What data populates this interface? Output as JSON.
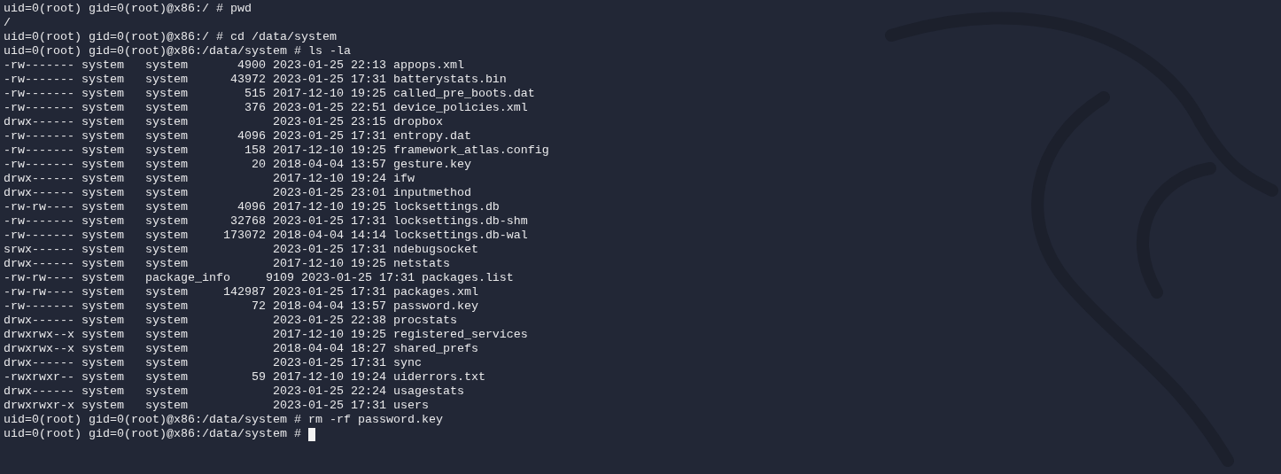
{
  "terminal": {
    "lines": [
      {
        "kind": "command",
        "prompt": "uid=0(root) gid=0(root)@x86:/ #",
        "command": "pwd"
      },
      {
        "kind": "output",
        "text": "/"
      },
      {
        "kind": "command",
        "prompt": "uid=0(root) gid=0(root)@x86:/ #",
        "command": "cd /data/system"
      },
      {
        "kind": "command",
        "prompt": "uid=0(root) gid=0(root)@x86:/data/system #",
        "command": "ls -la"
      },
      {
        "kind": "output",
        "text": "-rw------- system   system       4900 2023-01-25 22:13 appops.xml"
      },
      {
        "kind": "output",
        "text": "-rw------- system   system      43972 2023-01-25 17:31 batterystats.bin"
      },
      {
        "kind": "output",
        "text": "-rw------- system   system        515 2017-12-10 19:25 called_pre_boots.dat"
      },
      {
        "kind": "output",
        "text": "-rw------- system   system        376 2023-01-25 22:51 device_policies.xml"
      },
      {
        "kind": "output",
        "text": "drwx------ system   system            2023-01-25 23:15 dropbox"
      },
      {
        "kind": "output",
        "text": "-rw------- system   system       4096 2023-01-25 17:31 entropy.dat"
      },
      {
        "kind": "output",
        "text": "-rw------- system   system        158 2017-12-10 19:25 framework_atlas.config"
      },
      {
        "kind": "output",
        "text": "-rw------- system   system         20 2018-04-04 13:57 gesture.key"
      },
      {
        "kind": "output",
        "text": "drwx------ system   system            2017-12-10 19:24 ifw"
      },
      {
        "kind": "output",
        "text": "drwx------ system   system            2023-01-25 23:01 inputmethod"
      },
      {
        "kind": "output",
        "text": "-rw-rw---- system   system       4096 2017-12-10 19:25 locksettings.db"
      },
      {
        "kind": "output",
        "text": "-rw------- system   system      32768 2023-01-25 17:31 locksettings.db-shm"
      },
      {
        "kind": "output",
        "text": "-rw------- system   system     173072 2018-04-04 14:14 locksettings.db-wal"
      },
      {
        "kind": "output",
        "text": "srwx------ system   system            2023-01-25 17:31 ndebugsocket"
      },
      {
        "kind": "output",
        "text": "drwx------ system   system            2017-12-10 19:25 netstats"
      },
      {
        "kind": "output",
        "text": "-rw-rw---- system   package_info     9109 2023-01-25 17:31 packages.list"
      },
      {
        "kind": "output",
        "text": "-rw-rw---- system   system     142987 2023-01-25 17:31 packages.xml"
      },
      {
        "kind": "output",
        "text": "-rw------- system   system         72 2018-04-04 13:57 password.key"
      },
      {
        "kind": "output",
        "text": "drwx------ system   system            2023-01-25 22:38 procstats"
      },
      {
        "kind": "output",
        "text": "drwxrwx--x system   system            2017-12-10 19:25 registered_services"
      },
      {
        "kind": "output",
        "text": "drwxrwx--x system   system            2018-04-04 18:27 shared_prefs"
      },
      {
        "kind": "output",
        "text": "drwx------ system   system            2023-01-25 17:31 sync"
      },
      {
        "kind": "output",
        "text": "-rwxrwxr-- system   system         59 2017-12-10 19:24 uiderrors.txt"
      },
      {
        "kind": "output",
        "text": "drwx------ system   system            2023-01-25 22:24 usagestats"
      },
      {
        "kind": "output",
        "text": "drwxrwxr-x system   system            2023-01-25 17:31 users"
      },
      {
        "kind": "command",
        "prompt": "uid=0(root) gid=0(root)@x86:/data/system #",
        "command": "rm -rf password.key"
      },
      {
        "kind": "command",
        "prompt": "uid=0(root) gid=0(root)@x86:/data/system #",
        "cursor": true
      }
    ]
  }
}
